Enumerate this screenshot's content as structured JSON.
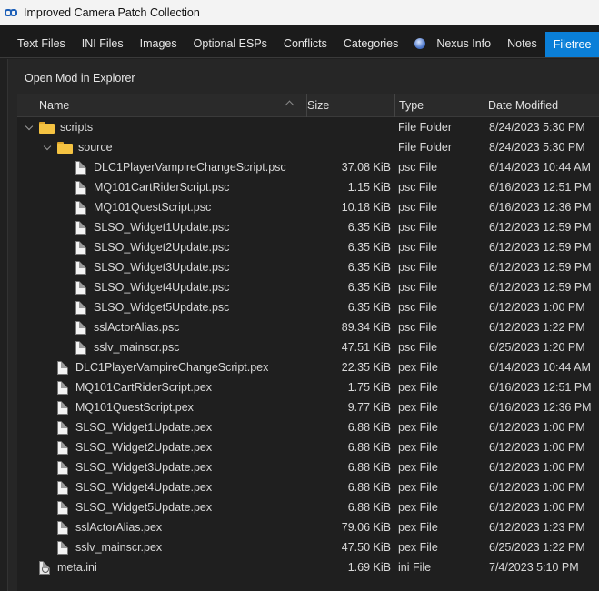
{
  "window": {
    "title": "Improved Camera Patch Collection"
  },
  "tabs": [
    {
      "label": "Text Files"
    },
    {
      "label": "INI Files"
    },
    {
      "label": "Images"
    },
    {
      "label": "Optional ESPs"
    },
    {
      "label": "Conflicts"
    },
    {
      "label": "Categories"
    },
    {
      "label": "Nexus Info",
      "icon": "globe-icon"
    },
    {
      "label": "Notes"
    },
    {
      "label": "Filetree",
      "active": true
    }
  ],
  "toolbar": {
    "open_mod_label": "Open Mod in Explorer"
  },
  "columns": {
    "name": "Name",
    "size": "Size",
    "type": "Type",
    "date": "Date Modified"
  },
  "colors": {
    "accent": "#0a7fd8",
    "folder": "#f5c342",
    "background": "#1f1f1f"
  },
  "rows": [
    {
      "name": "scripts",
      "size": "",
      "type": "File Folder",
      "date": "8/24/2023 5:30 PM",
      "kind": "folder",
      "depth": 0,
      "expanded": true
    },
    {
      "name": "source",
      "size": "",
      "type": "File Folder",
      "date": "8/24/2023 5:30 PM",
      "kind": "folder",
      "depth": 1,
      "expanded": true
    },
    {
      "name": "DLC1PlayerVampireChangeScript.psc",
      "size": "37.08 KiB",
      "type": "psc File",
      "date": "6/14/2023 10:44 AM",
      "kind": "file",
      "depth": 2
    },
    {
      "name": "MQ101CartRiderScript.psc",
      "size": "1.15 KiB",
      "type": "psc File",
      "date": "6/16/2023 12:51 PM",
      "kind": "file",
      "depth": 2
    },
    {
      "name": "MQ101QuestScript.psc",
      "size": "10.18 KiB",
      "type": "psc File",
      "date": "6/16/2023 12:36 PM",
      "kind": "file",
      "depth": 2
    },
    {
      "name": "SLSO_Widget1Update.psc",
      "size": "6.35 KiB",
      "type": "psc File",
      "date": "6/12/2023 12:59 PM",
      "kind": "file",
      "depth": 2
    },
    {
      "name": "SLSO_Widget2Update.psc",
      "size": "6.35 KiB",
      "type": "psc File",
      "date": "6/12/2023 12:59 PM",
      "kind": "file",
      "depth": 2
    },
    {
      "name": "SLSO_Widget3Update.psc",
      "size": "6.35 KiB",
      "type": "psc File",
      "date": "6/12/2023 12:59 PM",
      "kind": "file",
      "depth": 2
    },
    {
      "name": "SLSO_Widget4Update.psc",
      "size": "6.35 KiB",
      "type": "psc File",
      "date": "6/12/2023 12:59 PM",
      "kind": "file",
      "depth": 2
    },
    {
      "name": "SLSO_Widget5Update.psc",
      "size": "6.35 KiB",
      "type": "psc File",
      "date": "6/12/2023 1:00 PM",
      "kind": "file",
      "depth": 2
    },
    {
      "name": "sslActorAlias.psc",
      "size": "89.34 KiB",
      "type": "psc File",
      "date": "6/12/2023 1:22 PM",
      "kind": "file",
      "depth": 2
    },
    {
      "name": "sslv_mainscr.psc",
      "size": "47.51 KiB",
      "type": "psc File",
      "date": "6/25/2023 1:20 PM",
      "kind": "file",
      "depth": 2
    },
    {
      "name": "DLC1PlayerVampireChangeScript.pex",
      "size": "22.35 KiB",
      "type": "pex File",
      "date": "6/14/2023 10:44 AM",
      "kind": "file",
      "depth": 1
    },
    {
      "name": "MQ101CartRiderScript.pex",
      "size": "1.75 KiB",
      "type": "pex File",
      "date": "6/16/2023 12:51 PM",
      "kind": "file",
      "depth": 1
    },
    {
      "name": "MQ101QuestScript.pex",
      "size": "9.77 KiB",
      "type": "pex File",
      "date": "6/16/2023 12:36 PM",
      "kind": "file",
      "depth": 1
    },
    {
      "name": "SLSO_Widget1Update.pex",
      "size": "6.88 KiB",
      "type": "pex File",
      "date": "6/12/2023 1:00 PM",
      "kind": "file",
      "depth": 1
    },
    {
      "name": "SLSO_Widget2Update.pex",
      "size": "6.88 KiB",
      "type": "pex File",
      "date": "6/12/2023 1:00 PM",
      "kind": "file",
      "depth": 1
    },
    {
      "name": "SLSO_Widget3Update.pex",
      "size": "6.88 KiB",
      "type": "pex File",
      "date": "6/12/2023 1:00 PM",
      "kind": "file",
      "depth": 1
    },
    {
      "name": "SLSO_Widget4Update.pex",
      "size": "6.88 KiB",
      "type": "pex File",
      "date": "6/12/2023 1:00 PM",
      "kind": "file",
      "depth": 1
    },
    {
      "name": "SLSO_Widget5Update.pex",
      "size": "6.88 KiB",
      "type": "pex File",
      "date": "6/12/2023 1:00 PM",
      "kind": "file",
      "depth": 1
    },
    {
      "name": "sslActorAlias.pex",
      "size": "79.06 KiB",
      "type": "pex File",
      "date": "6/12/2023 1:23 PM",
      "kind": "file",
      "depth": 1
    },
    {
      "name": "sslv_mainscr.pex",
      "size": "47.50 KiB",
      "type": "pex File",
      "date": "6/25/2023 1:22 PM",
      "kind": "file",
      "depth": 1
    },
    {
      "name": "meta.ini",
      "size": "1.69 KiB",
      "type": "ini File",
      "date": "7/4/2023 5:10 PM",
      "kind": "ini",
      "depth": 0
    }
  ]
}
